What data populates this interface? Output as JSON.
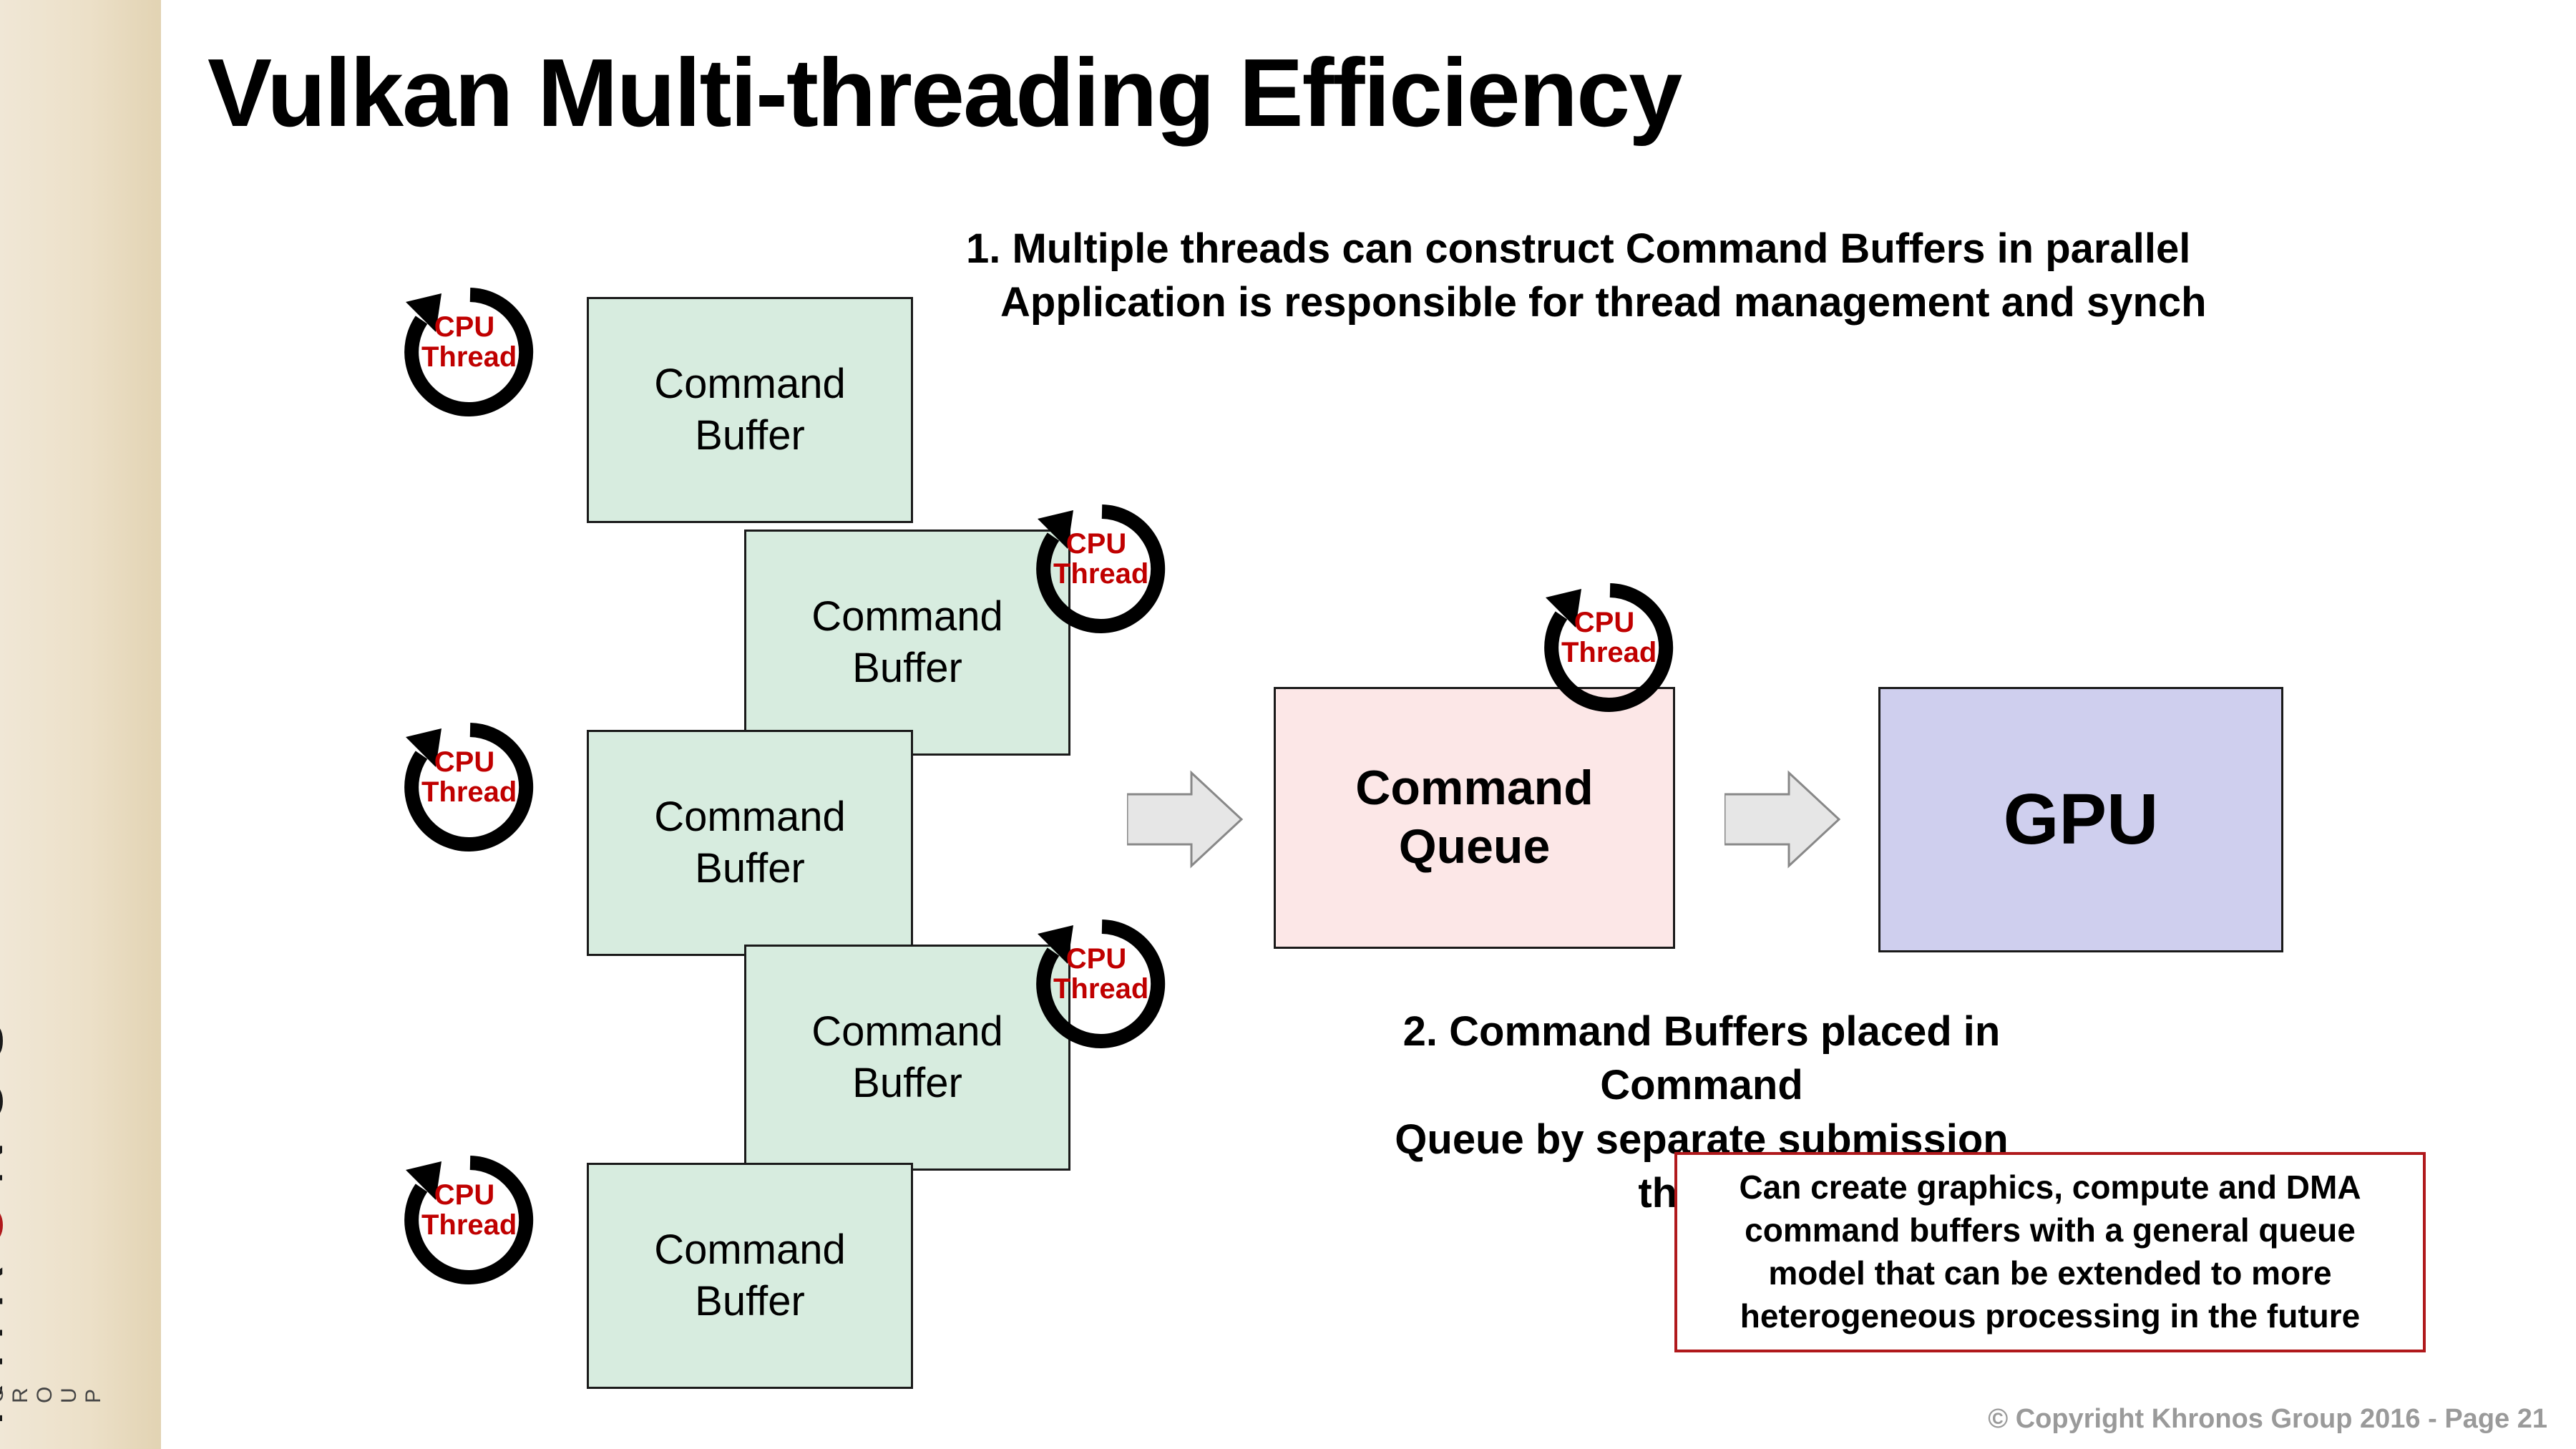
{
  "title": "Vulkan Multi-threading Efficiency",
  "step1_line1": "1. Multiple threads can construct Command Buffers in parallel",
  "step1_line2": "Application is responsible for thread management and synch",
  "step2_line1": "2. Command Buffers placed in Command",
  "step2_line2": "Queue by separate submission thread",
  "note": "Can create graphics, compute and DMA command buffers with a general queue model that can be extended to more heterogeneous processing in the future",
  "footer": "© Copyright Khronos Group 2016 - Page 21",
  "cmdbuf_label_l1": "Command",
  "cmdbuf_label_l2": "Buffer",
  "cmdq_label_l1": "Command",
  "cmdq_label_l2": "Queue",
  "gpu_label": "GPU",
  "cpu_thread_l1": "CPU",
  "cpu_thread_l2": "Thread",
  "logo": {
    "k": "KHR",
    "o": "O",
    "nos": "NOS",
    "tm": "™",
    "group": "G R O U P"
  }
}
